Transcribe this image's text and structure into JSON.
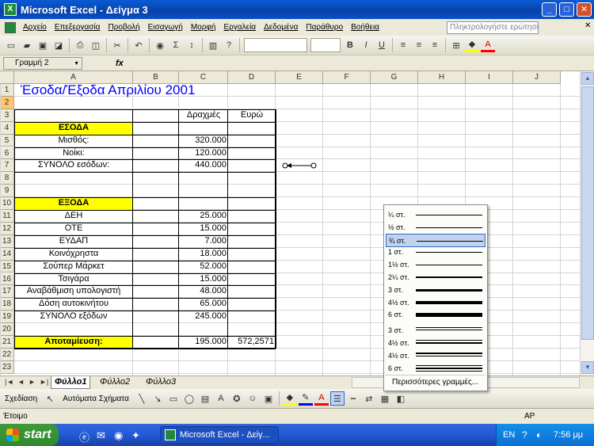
{
  "window": {
    "title": "Microsoft Excel - Δείγμα 3",
    "minimize": "_",
    "maximize": "□",
    "close": "✕"
  },
  "menu": {
    "items": [
      "Αρχείο",
      "Επεξεργασία",
      "Προβολή",
      "Εισαγωγή",
      "Μορφή",
      "Εργαλεία",
      "Δεδομένα",
      "Παράθυρο",
      "Βοήθεια"
    ],
    "ask_placeholder": "Πληκτρολογήστε ερώτηση",
    "close_doc": "✕"
  },
  "toolbar": {
    "bold": "B",
    "italic": "I",
    "underline": "U"
  },
  "formula_bar": {
    "name_box": "Γραμμή 2",
    "fx": "fx"
  },
  "columns": [
    "A",
    "B",
    "C",
    "D",
    "E",
    "F",
    "G",
    "H",
    "I",
    "J"
  ],
  "rows": [
    "1",
    "2",
    "3",
    "4",
    "5",
    "6",
    "7",
    "8",
    "9",
    "10",
    "11",
    "12",
    "13",
    "14",
    "15",
    "16",
    "17",
    "18",
    "19",
    "20",
    "21",
    "22",
    "23"
  ],
  "cells": {
    "title": "Έσοδα/Έξοδα Απριλίου 2001",
    "hdr_drachmas": "Δραχμές",
    "hdr_euro": "Ευρώ",
    "income_header": "ΕΣΟΔΑ",
    "salary": "Μισθός:",
    "rent": "Νοίκι:",
    "total_income_label": "ΣΥΝΟΛΟ εσόδων:",
    "salary_val": "320.000",
    "rent_val": "120.000",
    "total_income_val": "440.000",
    "expenses_header": "ΕΞΟΔΑ",
    "expenses": [
      {
        "label": "ΔΕΗ",
        "value": "25.000"
      },
      {
        "label": "ΟΤΕ",
        "value": "15.000"
      },
      {
        "label": "ΕΥΔΑΠ",
        "value": "7.000"
      },
      {
        "label": "Κοινόχρηστα",
        "value": "18.000"
      },
      {
        "label": "Σούπερ Μάρκετ",
        "value": "52.000"
      },
      {
        "label": "Τσιγάρα",
        "value": "15.000"
      },
      {
        "label": "Αναβάθμιση υπολογιστή",
        "value": "48.000"
      },
      {
        "label": "Δόση αυτοκινήτου",
        "value": "65.000"
      }
    ],
    "total_expenses_label": "ΣΥΝΟΛΟ εξόδων",
    "total_expenses_val": "245.000",
    "savings_label": "Αποταμίευση:",
    "savings_val": "195.000",
    "savings_euro": "572,2571"
  },
  "sheets": [
    "Φύλλο1",
    "Φύλλο2",
    "Φύλλο3"
  ],
  "tab_nav": [
    "|◄",
    "◄",
    "►",
    "►|"
  ],
  "drawing": {
    "draw_label": "Σχεδίαση",
    "autoshapes_label": "Αυτόματα Σχήματα"
  },
  "line_style_popup": {
    "options": [
      {
        "label": "¼ στ.",
        "weight": 0.25
      },
      {
        "label": "½ στ.",
        "weight": 0.5
      },
      {
        "label": "¾ στ.",
        "weight": 0.75
      },
      {
        "label": "1 στ.",
        "weight": 1
      },
      {
        "label": "1½ στ.",
        "weight": 1.5
      },
      {
        "label": "2¼ στ.",
        "weight": 2.25
      },
      {
        "label": "3 στ.",
        "weight": 3
      },
      {
        "label": "4½ στ.",
        "weight": 4.5
      },
      {
        "label": "6 στ.",
        "weight": 6
      },
      {
        "label": "3 στ.",
        "weight": 3
      },
      {
        "label": "4½ στ.",
        "weight": 4.5
      },
      {
        "label": "4½ στ.",
        "weight": 4.5
      },
      {
        "label": "6 στ.",
        "weight": 6
      }
    ],
    "selected_index": 2,
    "more": "Περισσότερες γραμμές..."
  },
  "status": {
    "ready": "Έτοιμο",
    "mode": "ΑΡ"
  },
  "taskbar": {
    "start": "start",
    "task": "Microsoft Excel - Δείγ...",
    "lang": "EN",
    "clock": "7:56 μμ"
  },
  "colors": {
    "accent_yellow": "#ffff00",
    "title_blue": "#0000ff",
    "title_bar": "#0842a8"
  }
}
